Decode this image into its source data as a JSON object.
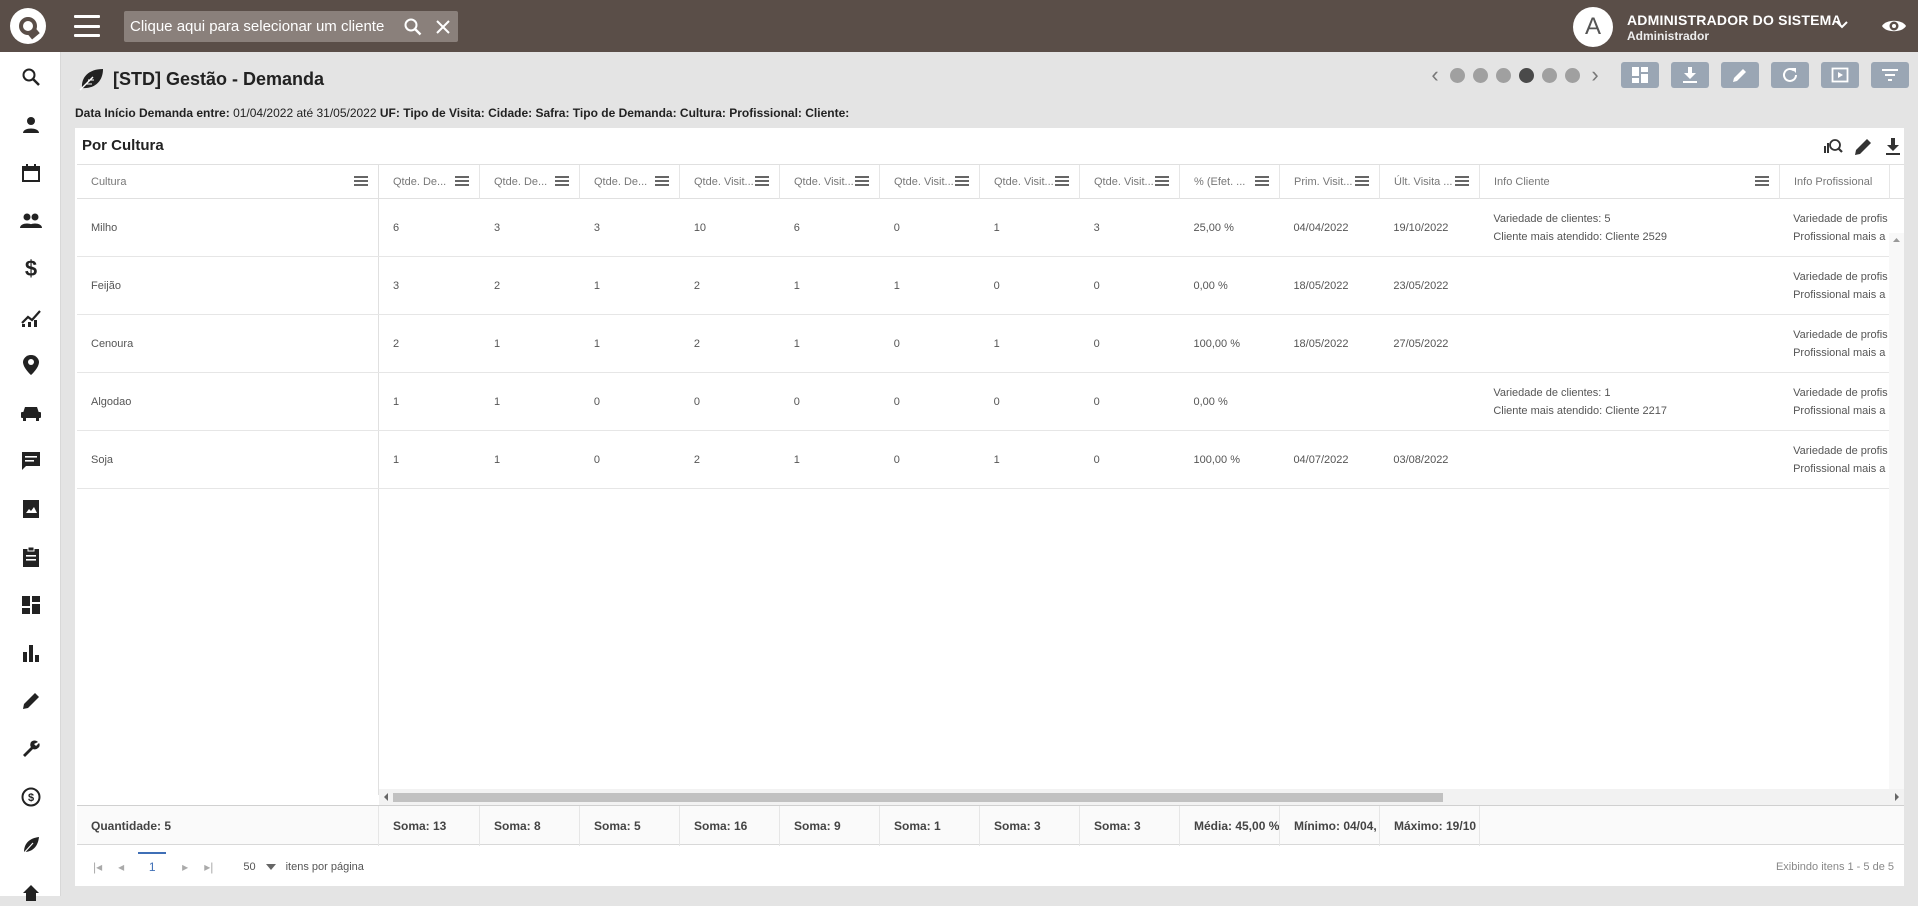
{
  "search": {
    "placeholder": "Clique aqui para selecionar um cliente"
  },
  "user": {
    "initial": "A",
    "name": "ADMINISTRADOR DO SISTEMA",
    "role": "Administrador"
  },
  "page": {
    "title": "[STD] Gestão - Demanda"
  },
  "filters": {
    "label1": "Data Início Demanda entre:",
    "value1": "01/04/2022 até 31/05/2022",
    "rest": "UF: Tipo de Visita: Cidade: Safra: Tipo de Demanda: Cultura: Profissional: Cliente:"
  },
  "panel": {
    "title": "Por Cultura"
  },
  "columns": [
    "Cultura",
    "Qtde. De...",
    "Qtde. De...",
    "Qtde. De...",
    "Qtde. Visit...",
    "Qtde. Visit...",
    "Qtde. Visit...",
    "Qtde. Visit...",
    "Qtde. Visit...",
    "% (Efet. ...",
    "Prim. Visit...",
    "Últ. Visita ...",
    "Info Cliente",
    "Info Profissional"
  ],
  "rows": [
    {
      "cultura": "Milho",
      "vals": [
        "6",
        "3",
        "3",
        "10",
        "6",
        "0",
        "1",
        "3",
        "25,00 %",
        "04/04/2022",
        "19/10/2022"
      ],
      "info_cliente": [
        "Variedade de clientes: 5",
        "Cliente mais atendido: Cliente 2529"
      ],
      "info_prof": [
        "Variedade de profis",
        "Profissional mais a"
      ]
    },
    {
      "cultura": "Feijão",
      "vals": [
        "3",
        "2",
        "1",
        "2",
        "1",
        "1",
        "0",
        "0",
        "0,00 %",
        "18/05/2022",
        "23/05/2022"
      ],
      "info_cliente": [
        "",
        ""
      ],
      "info_prof": [
        "Variedade de profis",
        "Profissional mais a"
      ]
    },
    {
      "cultura": "Cenoura",
      "vals": [
        "2",
        "1",
        "1",
        "2",
        "1",
        "0",
        "1",
        "0",
        "100,00 %",
        "18/05/2022",
        "27/05/2022"
      ],
      "info_cliente": [
        "",
        ""
      ],
      "info_prof": [
        "Variedade de profis",
        "Profissional mais a"
      ]
    },
    {
      "cultura": "Algodao",
      "vals": [
        "1",
        "1",
        "0",
        "0",
        "0",
        "0",
        "0",
        "0",
        "0,00 %",
        "",
        ""
      ],
      "info_cliente": [
        "Variedade de clientes: 1",
        "Cliente mais atendido: Cliente 2217"
      ],
      "info_prof": [
        "Variedade de profis",
        "Profissional mais a"
      ]
    },
    {
      "cultura": "Soja",
      "vals": [
        "1",
        "1",
        "0",
        "2",
        "1",
        "0",
        "1",
        "0",
        "100,00 %",
        "04/07/2022",
        "03/08/2022"
      ],
      "info_cliente": [
        "",
        ""
      ],
      "info_prof": [
        "Variedade de profis",
        "Profissional mais a"
      ]
    }
  ],
  "footer": [
    "Quantidade: 5",
    "Soma: 13",
    "Soma: 8",
    "Soma: 5",
    "Soma: 16",
    "Soma: 9",
    "Soma: 1",
    "Soma: 3",
    "Soma: 3",
    "Média: 45,00 %",
    "Mínimo: 04/04,",
    "Máximo: 19/10"
  ],
  "pager": {
    "current_page": "1",
    "page_size": "50",
    "per_page_label": "itens por página",
    "range": "Exibindo itens 1 - 5 de 5"
  },
  "colors": {
    "topbar": "#5a4e48",
    "accent": "#3f6fb6",
    "toolbar_button": "#9aa6b4"
  }
}
